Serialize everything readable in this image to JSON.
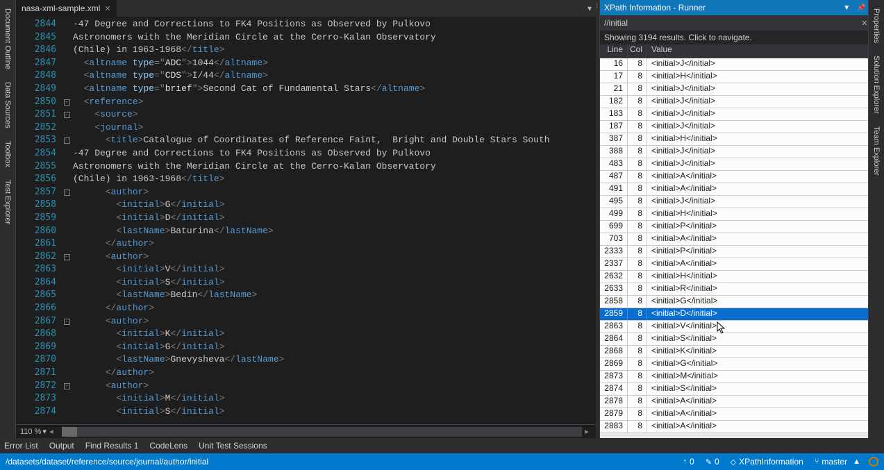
{
  "leftTabs": [
    "Document Outline",
    "Data Sources",
    "Toolbox",
    "Test Explorer"
  ],
  "rightTabs": [
    "Properties",
    "Solution Explorer",
    "Team Explorer"
  ],
  "tabFile": "nasa-xml-sample.xml",
  "zoom": "110 %",
  "bottomTabs": [
    "Error List",
    "Output",
    "Find Results 1",
    "CodeLens",
    "Unit Test Sessions"
  ],
  "statusPath": "/datasets/dataset/reference/source/journal/author/initial",
  "statusItems": {
    "upCount": "0",
    "editCount": "0",
    "extName": "XPathInformation",
    "branch": "master"
  },
  "panel": {
    "title": "XPath Information - Runner",
    "query": "//initial",
    "status": "Showing 3194 results. Click to navigate.",
    "headers": {
      "line": "Line",
      "col": "Col",
      "value": "Value"
    }
  },
  "code": [
    {
      "ln": 2844,
      "fold": "",
      "html": "<span class='t-text'>-47 Degree and Corrections to FK4 Positions as Observed by Pulkovo</span>"
    },
    {
      "ln": 2845,
      "fold": "",
      "html": "<span class='t-text'>Astronomers with the Meridian Circle at the Cerro-Kalan Observatory</span>"
    },
    {
      "ln": 2846,
      "fold": "",
      "html": "<span class='t-text'>(Chile) in 1963-1968</span><span class='t-punc'>&lt;/</span><span class='t-tag'>title</span><span class='t-punc'>&gt;</span>"
    },
    {
      "ln": 2847,
      "fold": "",
      "html": "  <span class='t-punc'>&lt;</span><span class='t-tag'>altname</span> <span class='t-attr'>type</span><span class='t-punc'>=</span><span class='t-punc'>\"</span><span class='t-str'>ADC</span><span class='t-punc'>\"&gt;</span><span class='t-text'>1044</span><span class='t-punc'>&lt;/</span><span class='t-tag'>altname</span><span class='t-punc'>&gt;</span>"
    },
    {
      "ln": 2848,
      "fold": "",
      "html": "  <span class='t-punc'>&lt;</span><span class='t-tag'>altname</span> <span class='t-attr'>type</span><span class='t-punc'>=</span><span class='t-punc'>\"</span><span class='t-str'>CDS</span><span class='t-punc'>\"&gt;</span><span class='t-text'>I/44</span><span class='t-punc'>&lt;/</span><span class='t-tag'>altname</span><span class='t-punc'>&gt;</span>"
    },
    {
      "ln": 2849,
      "fold": "",
      "html": "  <span class='t-punc'>&lt;</span><span class='t-tag'>altname</span> <span class='t-attr'>type</span><span class='t-punc'>=</span><span class='t-punc'>\"</span><span class='t-str'>brief</span><span class='t-punc'>\"&gt;</span><span class='t-text'>Second Cat of Fundamental Stars</span><span class='t-punc'>&lt;/</span><span class='t-tag'>altname</span><span class='t-punc'>&gt;</span>"
    },
    {
      "ln": 2850,
      "fold": "box",
      "html": "  <span class='t-punc'>&lt;</span><span class='t-tag'>reference</span><span class='t-punc'>&gt;</span>"
    },
    {
      "ln": 2851,
      "fold": "box",
      "html": "    <span class='t-punc'>&lt;</span><span class='t-tag'>source</span><span class='t-punc'>&gt;</span>"
    },
    {
      "ln": 2852,
      "fold": "",
      "html": "    <span class='t-punc'>&lt;</span><span class='t-tag'>journal</span><span class='t-punc'>&gt;</span>"
    },
    {
      "ln": 2853,
      "fold": "box",
      "html": "      <span class='t-punc'>&lt;</span><span class='t-tag'>title</span><span class='t-punc'>&gt;</span><span class='t-text'>Catalogue of Coordinates of Reference Faint,  Bright and Double Stars South </span>"
    },
    {
      "ln": 2854,
      "fold": "",
      "html": "<span class='t-text'>-47 Degree and Corrections to FK4 Positions as Observed by Pulkovo</span>"
    },
    {
      "ln": 2855,
      "fold": "",
      "html": "<span class='t-text'>Astronomers with the Meridian Circle at the Cerro-Kalan Observatory</span>"
    },
    {
      "ln": 2856,
      "fold": "",
      "html": "<span class='t-text'>(Chile) in 1963-1968</span><span class='t-punc'>&lt;/</span><span class='t-tag'>title</span><span class='t-punc'>&gt;</span>"
    },
    {
      "ln": 2857,
      "fold": "box",
      "html": "      <span class='t-punc'>&lt;</span><span class='t-tag'>author</span><span class='t-punc'>&gt;</span>"
    },
    {
      "ln": 2858,
      "fold": "",
      "html": "        <span class='t-punc'>&lt;</span><span class='t-tag'>initial</span><span class='t-punc'>&gt;</span><span class='t-text'>G</span><span class='t-punc'>&lt;/</span><span class='t-tag'>initial</span><span class='t-punc'>&gt;</span>"
    },
    {
      "ln": 2859,
      "fold": "",
      "html": "        <span class='t-punc'>&lt;</span><span class='t-tag'>initial</span><span class='t-punc'>&gt;</span><span class='t-text'>D</span><span class='t-punc'>&lt;/</span><span class='t-tag'>initial</span><span class='t-punc'>&gt;</span>"
    },
    {
      "ln": 2860,
      "fold": "",
      "html": "        <span class='t-punc'>&lt;</span><span class='t-tag'>lastName</span><span class='t-punc'>&gt;</span><span class='t-text'>Baturina</span><span class='t-punc'>&lt;/</span><span class='t-tag'>lastName</span><span class='t-punc'>&gt;</span>"
    },
    {
      "ln": 2861,
      "fold": "",
      "html": "      <span class='t-punc'>&lt;/</span><span class='t-tag'>author</span><span class='t-punc'>&gt;</span>"
    },
    {
      "ln": 2862,
      "fold": "box",
      "html": "      <span class='t-punc'>&lt;</span><span class='t-tag'>author</span><span class='t-punc'>&gt;</span>"
    },
    {
      "ln": 2863,
      "fold": "",
      "html": "        <span class='t-punc'>&lt;</span><span class='t-tag'>initial</span><span class='t-punc'>&gt;</span><span class='t-text'>V</span><span class='t-punc'>&lt;/</span><span class='t-tag'>initial</span><span class='t-punc'>&gt;</span>"
    },
    {
      "ln": 2864,
      "fold": "",
      "html": "        <span class='t-punc'>&lt;</span><span class='t-tag'>initial</span><span class='t-punc'>&gt;</span><span class='t-text'>S</span><span class='t-punc'>&lt;/</span><span class='t-tag'>initial</span><span class='t-punc'>&gt;</span>"
    },
    {
      "ln": 2865,
      "fold": "",
      "html": "        <span class='t-punc'>&lt;</span><span class='t-tag'>lastName</span><span class='t-punc'>&gt;</span><span class='t-text'>Bedin</span><span class='t-punc'>&lt;/</span><span class='t-tag'>lastName</span><span class='t-punc'>&gt;</span>"
    },
    {
      "ln": 2866,
      "fold": "",
      "html": "      <span class='t-punc'>&lt;/</span><span class='t-tag'>author</span><span class='t-punc'>&gt;</span>"
    },
    {
      "ln": 2867,
      "fold": "box",
      "html": "      <span class='t-punc'>&lt;</span><span class='t-tag'>author</span><span class='t-punc'>&gt;</span>"
    },
    {
      "ln": 2868,
      "fold": "",
      "html": "        <span class='t-punc'>&lt;</span><span class='t-tag'>initial</span><span class='t-punc'>&gt;</span><span class='t-text'>K</span><span class='t-punc'>&lt;/</span><span class='t-tag'>initial</span><span class='t-punc'>&gt;</span>"
    },
    {
      "ln": 2869,
      "fold": "",
      "html": "        <span class='t-punc'>&lt;</span><span class='t-tag'>initial</span><span class='t-punc'>&gt;</span><span class='t-text'>G</span><span class='t-punc'>&lt;/</span><span class='t-tag'>initial</span><span class='t-punc'>&gt;</span>"
    },
    {
      "ln": 2870,
      "fold": "",
      "html": "        <span class='t-punc'>&lt;</span><span class='t-tag'>lastName</span><span class='t-punc'>&gt;</span><span class='t-text'>Gnevysheva</span><span class='t-punc'>&lt;/</span><span class='t-tag'>lastName</span><span class='t-punc'>&gt;</span>"
    },
    {
      "ln": 2871,
      "fold": "",
      "html": "      <span class='t-punc'>&lt;/</span><span class='t-tag'>author</span><span class='t-punc'>&gt;</span>"
    },
    {
      "ln": 2872,
      "fold": "box",
      "html": "      <span class='t-punc'>&lt;</span><span class='t-tag'>author</span><span class='t-punc'>&gt;</span>"
    },
    {
      "ln": 2873,
      "fold": "",
      "html": "        <span class='t-punc'>&lt;</span><span class='t-tag'>initial</span><span class='t-punc'>&gt;</span><span class='t-text'>M</span><span class='t-punc'>&lt;/</span><span class='t-tag'>initial</span><span class='t-punc'>&gt;</span>"
    },
    {
      "ln": 2874,
      "fold": "",
      "html": "        <span class='t-punc'>&lt;</span><span class='t-tag'>initial</span><span class='t-punc'>&gt;</span><span class='t-text'>S</span><span class='t-punc'>&lt;/</span><span class='t-tag'>initial</span><span class='t-punc'>&gt;</span>"
    }
  ],
  "rows": [
    {
      "line": 16,
      "col": 8,
      "val": "<initial>J</initial>"
    },
    {
      "line": 17,
      "col": 8,
      "val": "<initial>H</initial>"
    },
    {
      "line": 21,
      "col": 8,
      "val": "<initial>J</initial>"
    },
    {
      "line": 182,
      "col": 8,
      "val": "<initial>J</initial>"
    },
    {
      "line": 183,
      "col": 8,
      "val": "<initial>J</initial>"
    },
    {
      "line": 187,
      "col": 8,
      "val": "<initial>J</initial>"
    },
    {
      "line": 387,
      "col": 8,
      "val": "<initial>H</initial>"
    },
    {
      "line": 388,
      "col": 8,
      "val": "<initial>J</initial>"
    },
    {
      "line": 483,
      "col": 8,
      "val": "<initial>J</initial>"
    },
    {
      "line": 487,
      "col": 8,
      "val": "<initial>A</initial>"
    },
    {
      "line": 491,
      "col": 8,
      "val": "<initial>A</initial>"
    },
    {
      "line": 495,
      "col": 8,
      "val": "<initial>J</initial>"
    },
    {
      "line": 499,
      "col": 8,
      "val": "<initial>H</initial>"
    },
    {
      "line": 699,
      "col": 8,
      "val": "<initial>P</initial>"
    },
    {
      "line": 703,
      "col": 8,
      "val": "<initial>A</initial>"
    },
    {
      "line": 2333,
      "col": 8,
      "val": "<initial>P</initial>"
    },
    {
      "line": 2337,
      "col": 8,
      "val": "<initial>A</initial>"
    },
    {
      "line": 2632,
      "col": 8,
      "val": "<initial>H</initial>"
    },
    {
      "line": 2633,
      "col": 8,
      "val": "<initial>R</initial>"
    },
    {
      "line": 2858,
      "col": 8,
      "val": "<initial>G</initial>"
    },
    {
      "line": 2859,
      "col": 8,
      "val": "<initial>D</initial>",
      "sel": true
    },
    {
      "line": 2863,
      "col": 8,
      "val": "<initial>V</initial>"
    },
    {
      "line": 2864,
      "col": 8,
      "val": "<initial>S</initial>"
    },
    {
      "line": 2868,
      "col": 8,
      "val": "<initial>K</initial>"
    },
    {
      "line": 2869,
      "col": 8,
      "val": "<initial>G</initial>"
    },
    {
      "line": 2873,
      "col": 8,
      "val": "<initial>M</initial>"
    },
    {
      "line": 2874,
      "col": 8,
      "val": "<initial>S</initial>"
    },
    {
      "line": 2878,
      "col": 8,
      "val": "<initial>A</initial>"
    },
    {
      "line": 2879,
      "col": 8,
      "val": "<initial>A</initial>"
    },
    {
      "line": 2883,
      "col": 8,
      "val": "<initial>A</initial>"
    }
  ]
}
